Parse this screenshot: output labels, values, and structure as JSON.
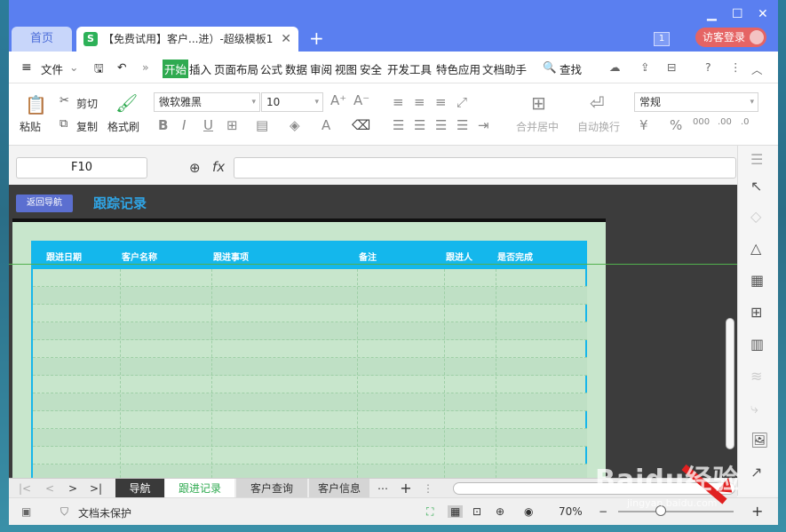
{
  "titlebar": {
    "home_tab": "首页",
    "doc_tab": "【免费试用】客户...进）-超级模板1",
    "doc_icon": "S",
    "login": "访客登录",
    "badge": "1"
  },
  "menu": {
    "file": "文件",
    "items": [
      "开始",
      "插入",
      "页面布局",
      "公式",
      "数据",
      "审阅",
      "视图",
      "安全",
      "开发工具",
      "特色应用",
      "文档助手"
    ],
    "search": "查找"
  },
  "ribbon": {
    "paste": "粘贴",
    "cut": "剪切",
    "copy": "复制",
    "format_painter": "格式刷",
    "font": "微软雅黑",
    "size": "10",
    "merge": "合并居中",
    "wrap": "自动换行",
    "numfmt": "常规"
  },
  "formula": {
    "cell": "F10",
    "fx": "fx",
    "value": ""
  },
  "sheet": {
    "nav_button": "返回导航",
    "title": "跟踪记录",
    "headers": [
      "跟进日期",
      "客户名称",
      "跟进事项",
      "备注",
      "跟进人",
      "是否完成"
    ]
  },
  "sheet_tabs": [
    "导航",
    "跟进记录",
    "客户查询",
    "客户信息"
  ],
  "active_sheet": "跟进记录",
  "status": {
    "protect": "文档未保护",
    "zoom": "70%"
  },
  "watermark": {
    "brand": "Baidu经验",
    "url": "jingyan.baidu.com"
  },
  "colors": {
    "title_bar": "#5a7ff0",
    "accent_green": "#2faa50",
    "header_blue": "#14b7ec",
    "sheet_bg": "#c8e6cc"
  }
}
